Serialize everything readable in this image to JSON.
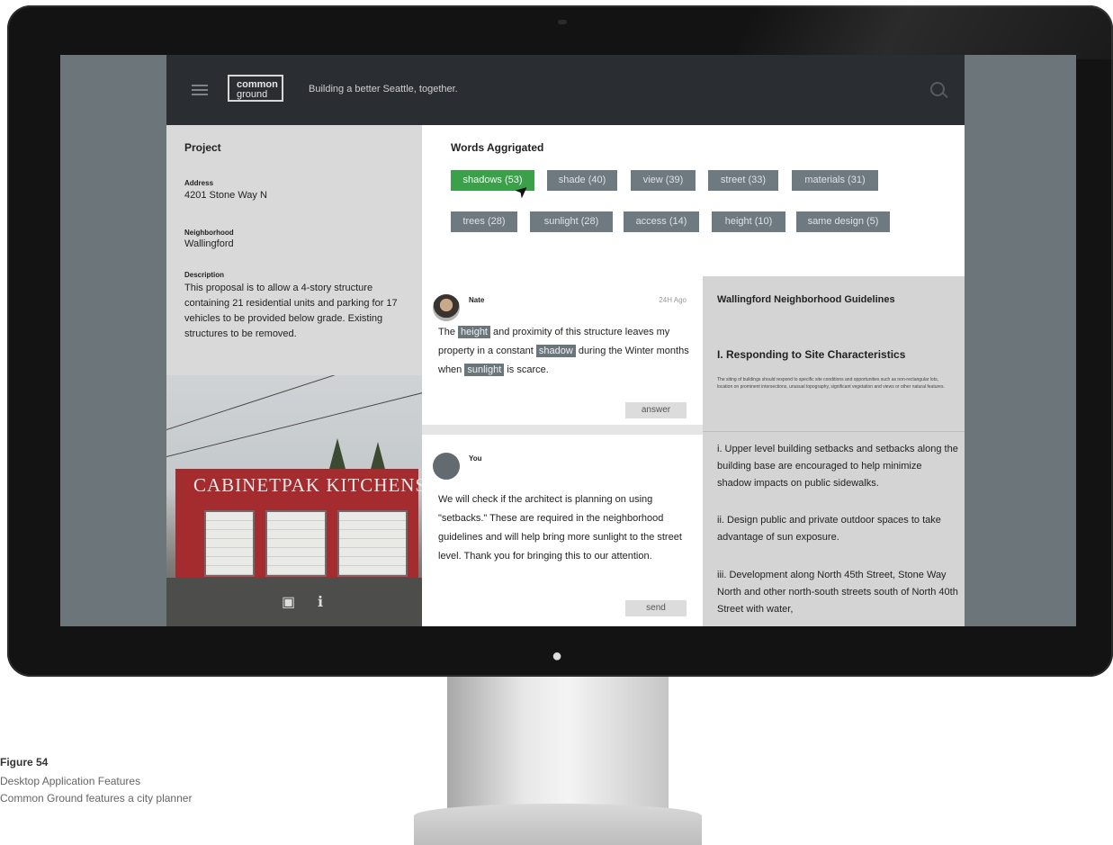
{
  "app": {
    "logo_line1": "common",
    "logo_line2": "ground",
    "tagline": "Building a better Seattle, together."
  },
  "project": {
    "title": "Project",
    "address_label": "Address",
    "address": "4201 Stone Way N",
    "neighborhood_label": "Neighborhood",
    "neighborhood": "Wallingford",
    "description_label": "Description",
    "description": "This proposal is to allow a 4-story structure containing 21 residential units and parking for 17 vehicles to be provided below grade. Existing structures to be removed.",
    "photo_sign": "CABINETPAK  KITCHENS"
  },
  "words": {
    "title": "Words Aggrigated",
    "tags": [
      {
        "label": "shadows (53)",
        "active": true
      },
      {
        "label": "shade (40)"
      },
      {
        "label": "view (39)"
      },
      {
        "label": "street (33)"
      },
      {
        "label": "materials (31)"
      },
      {
        "label": "trees (28)"
      },
      {
        "label": "sunlight (28)"
      },
      {
        "label": "access (14)"
      },
      {
        "label": "height (10)"
      },
      {
        "label": "same design (5)"
      }
    ]
  },
  "comments": [
    {
      "name": "Nate",
      "time": "24H Ago",
      "parts": [
        "The ",
        "height",
        " and proximity of this structure leaves my property in a constant ",
        "shadow",
        " during the Winter months when ",
        "sunlight",
        " is scarce."
      ],
      "button": "answer"
    },
    {
      "name": "You",
      "body": "We will check if the architect is planning on using \"setbacks.\" These are required in the neighborhood guidelines and will help bring more sunlight to the street level. Thank you for bringing this to our attention.",
      "button": "send"
    }
  ],
  "guidelines": {
    "title": "Wallingford Neighborhood Guidelines",
    "section": "I. Responding to Site Characteristics",
    "fine_print": "The siting of buildings should respond to specific site conditions and opportunities such as non-rectangular lots, location on prominent intersections, unusual topography, significant vegetation and views or other natural features.",
    "items": [
      "i. Upper level building setbacks and setbacks along the building base are encouraged to help minimize shadow impacts on public sidewalks.",
      "ii. Design public and private outdoor spaces to take advantage of sun exposure.",
      "iii. Development along North 45th Street, Stone Way North and other north-south streets south of North 40th Street with water,"
    ]
  },
  "caption": {
    "title": "Figure 54",
    "line1": "Desktop Application Features",
    "line2": "Common Ground features a city planner"
  },
  "colors": {
    "topbar": "#2a2d31",
    "tag": "#6f7a80",
    "tag_active": "#3aa14a",
    "panel": "#d9d9d9"
  }
}
